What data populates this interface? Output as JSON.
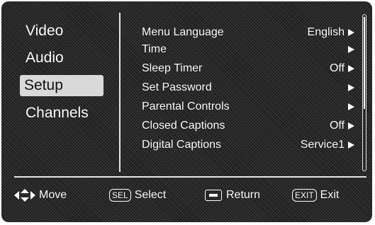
{
  "sidebar": {
    "items": [
      {
        "label": "Video",
        "selected": false
      },
      {
        "label": "Audio",
        "selected": false
      },
      {
        "label": "Setup",
        "selected": true
      },
      {
        "label": "Channels",
        "selected": false
      }
    ]
  },
  "menu": {
    "rows": [
      {
        "label": "Menu Language",
        "value": "English",
        "has_arrow": true
      },
      {
        "label": "Time",
        "value": "",
        "has_arrow": true
      },
      {
        "label": "Sleep Timer",
        "value": "Off",
        "has_arrow": true
      },
      {
        "label": "Set Password",
        "value": "",
        "has_arrow": true
      },
      {
        "label": "Parental Controls",
        "value": "",
        "has_arrow": true
      },
      {
        "label": "Closed Captions",
        "value": "Off",
        "has_arrow": true
      },
      {
        "label": "Digital Captions",
        "value": "Service1",
        "has_arrow": true
      }
    ]
  },
  "footer": {
    "move": {
      "icon": "dpad-icon",
      "label": "Move"
    },
    "select": {
      "key": "SEL",
      "label": "Select"
    },
    "return": {
      "icon": "return-key-icon",
      "label": "Return"
    },
    "exit": {
      "key": "EXIT",
      "label": "Exit"
    }
  },
  "colors": {
    "background": "#1a1a1a",
    "text": "#ffffff",
    "selected_bg": "#d9d9d9"
  }
}
